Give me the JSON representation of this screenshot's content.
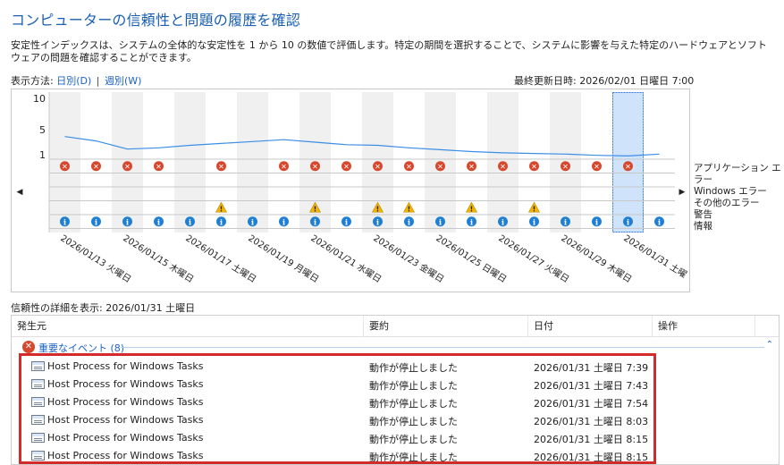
{
  "title": "コンピューターの信頼性と問題の履歴を確認",
  "description": "安定性インデックスは、システムの全体的な安定性を 1 から 10 の数値で評価します。特定の期間を選択することで、システムに影響を与えた特定のハードウェアとソフトウェアの問題を確認することができます。",
  "view": {
    "label": "表示方法:",
    "daily": "日別(D)",
    "separator": "|",
    "weekly": "週別(W)"
  },
  "last_updated": "最終更新日時: 2026/02/01 日曜日 7:00",
  "chart": {
    "y_ticks": [
      "10",
      "5",
      "1"
    ],
    "dates": [
      "2026/01/13 火曜日",
      "2026/01/15 木曜日",
      "2026/01/17 土曜日",
      "2026/01/19 月曜日",
      "2026/01/21 水曜日",
      "2026/01/23 金曜日",
      "2026/01/25 日曜日",
      "2026/01/27 火曜日",
      "2026/01/29 木曜日",
      "2026/01/31 土曜"
    ],
    "days_visible": 20,
    "selected_day_index": 18,
    "stability_index": [
      3.9,
      3.2,
      1.9,
      2.1,
      2.5,
      2.8,
      3.1,
      3.4,
      3.0,
      2.6,
      2.5,
      2.1,
      1.8,
      1.5,
      1.3,
      1.2,
      1.1,
      0.9,
      0.8,
      1.1
    ],
    "app_errors": [
      1,
      1,
      1,
      1,
      0,
      1,
      0,
      1,
      1,
      1,
      1,
      1,
      1,
      1,
      1,
      1,
      1,
      1,
      1,
      0
    ],
    "warnings": [
      0,
      0,
      0,
      0,
      0,
      1,
      0,
      0,
      1,
      0,
      1,
      1,
      0,
      1,
      0,
      1,
      0,
      0,
      0,
      0
    ],
    "info": [
      1,
      1,
      1,
      1,
      1,
      1,
      1,
      1,
      1,
      1,
      1,
      1,
      1,
      1,
      1,
      1,
      1,
      1,
      1,
      1
    ],
    "nav_left": "◀",
    "nav_right": "▶",
    "line_color": "#3a8ee6",
    "error_color": "#d6482d",
    "warning_color": "#f2b400",
    "info_color": "#1f7fd4",
    "selected_color": "#cfe3fb"
  },
  "legend": [
    "アプリケーション エラー",
    "Windows エラー",
    "その他のエラー",
    "警告",
    "情報"
  ],
  "detail_label": "信頼性の詳細を表示: 2026/01/31 土曜日",
  "table": {
    "columns": [
      "発生元",
      "要約",
      "日付",
      "操作"
    ],
    "sort_caret": "^",
    "group": {
      "icon": "✕",
      "label": "重要なイベント (8)",
      "collapse": "⌃"
    },
    "rows": [
      {
        "source": "Host Process for Windows Tasks",
        "summary": "動作が停止しました",
        "date": "2026/01/31 土曜日 7:39"
      },
      {
        "source": "Host Process for Windows Tasks",
        "summary": "動作が停止しました",
        "date": "2026/01/31 土曜日 7:43"
      },
      {
        "source": "Host Process for Windows Tasks",
        "summary": "動作が停止しました",
        "date": "2026/01/31 土曜日 7:54"
      },
      {
        "source": "Host Process for Windows Tasks",
        "summary": "動作が停止しました",
        "date": "2026/01/31 土曜日 8:03"
      },
      {
        "source": "Host Process for Windows Tasks",
        "summary": "動作が停止しました",
        "date": "2026/01/31 土曜日 8:15"
      },
      {
        "source": "Host Process for Windows Tasks",
        "summary": "動作が停止しました",
        "date": "2026/01/31 土曜日 8:15"
      }
    ]
  }
}
